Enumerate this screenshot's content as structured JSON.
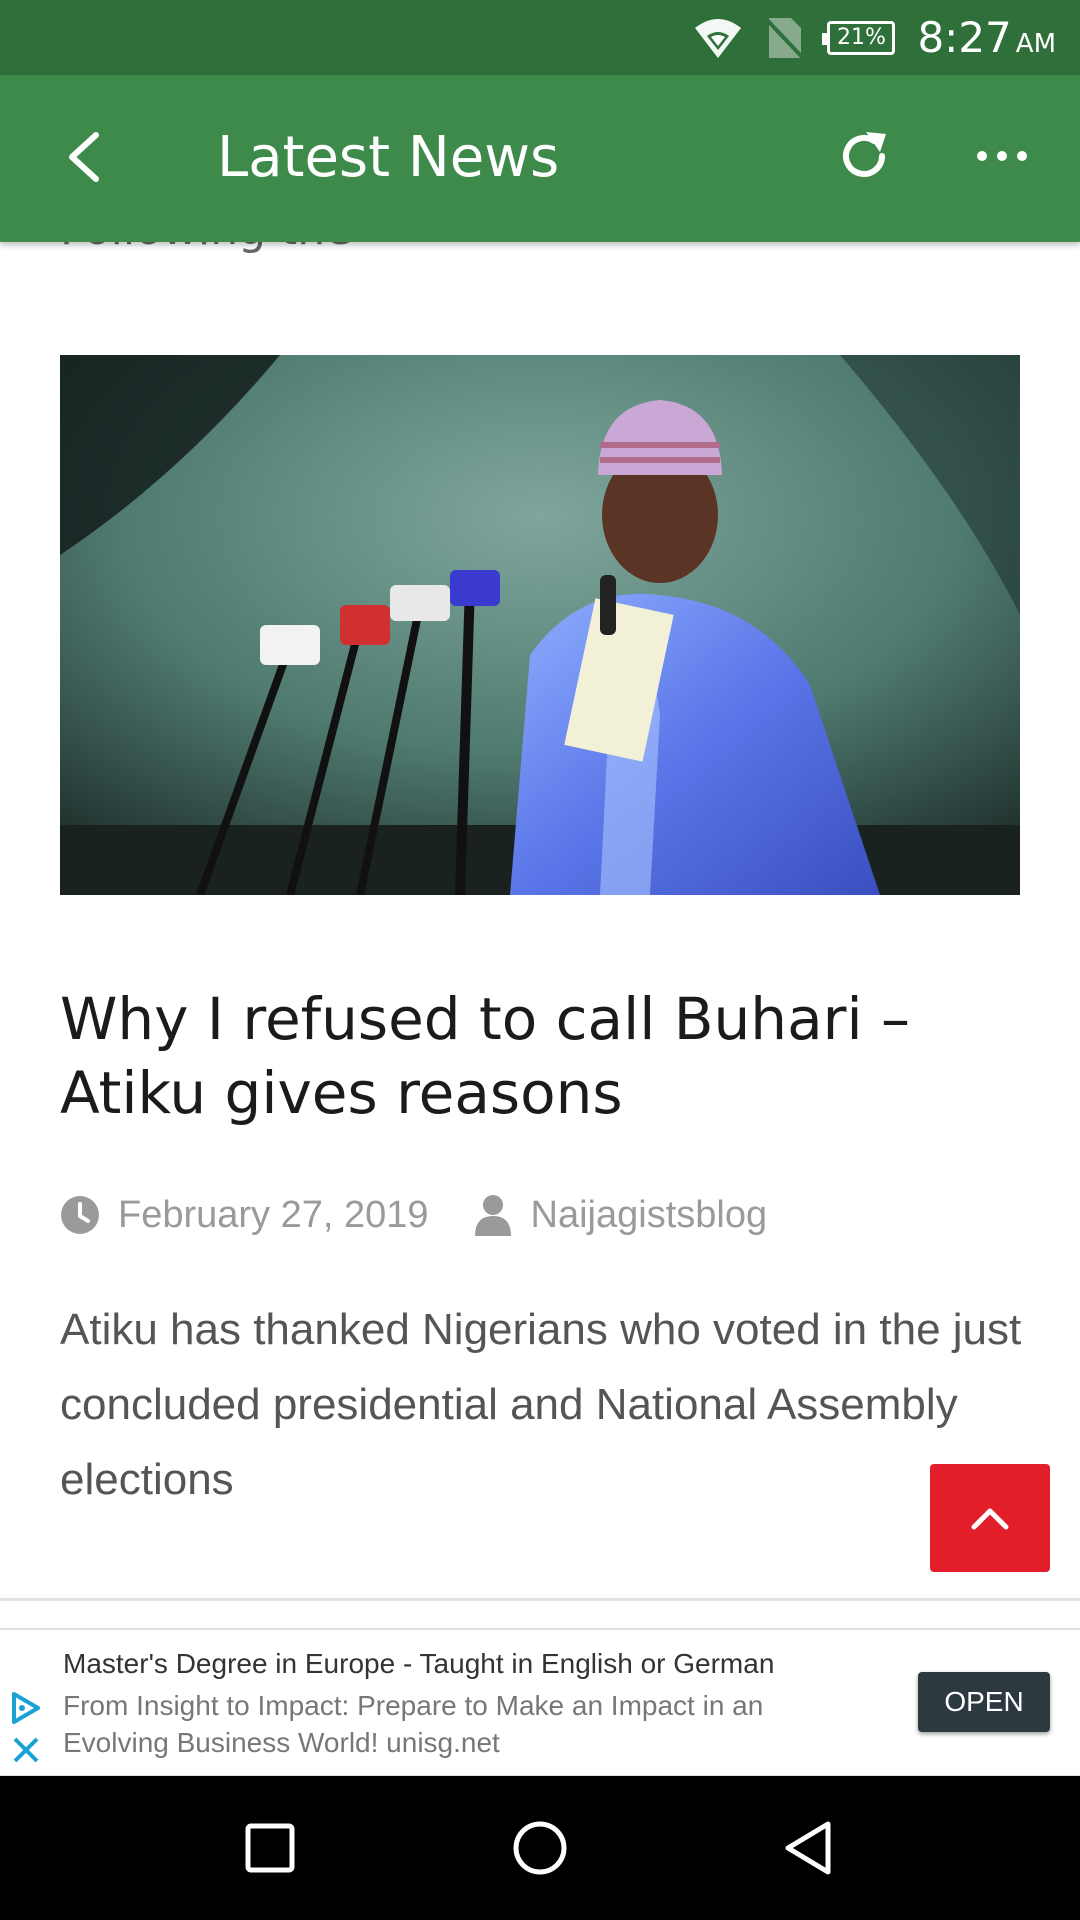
{
  "status_bar": {
    "battery": "21%",
    "time": "8:27",
    "ampm": "AM"
  },
  "app_bar": {
    "title": "Latest News"
  },
  "article": {
    "previous_fragment": "Following the",
    "headline": "Why I refused to call Buhari – Atiku gives reasons",
    "date": "February 27, 2019",
    "author": "Naijagistsblog",
    "excerpt": "Atiku has thanked Nigerians who voted in the just concluded presidential and National Assembly elections"
  },
  "ad": {
    "title": "Master's Degree in Europe - Taught in English or German",
    "description": "From Insight to Impact: Prepare to Make an Impact in an Evolving Business World! unisg.net",
    "open_label": "OPEN"
  },
  "colors": {
    "status_bar": "#2f6f3a",
    "app_bar": "#3e8a4a",
    "scroll_top": "#e31e2b",
    "ad_button": "#2c3a40"
  },
  "icons": {
    "back": "chevron-left-icon",
    "refresh": "refresh-icon",
    "more": "more-horizontal-icon",
    "scroll_top": "chevron-up-icon",
    "date": "clock-icon",
    "author": "user-icon"
  }
}
